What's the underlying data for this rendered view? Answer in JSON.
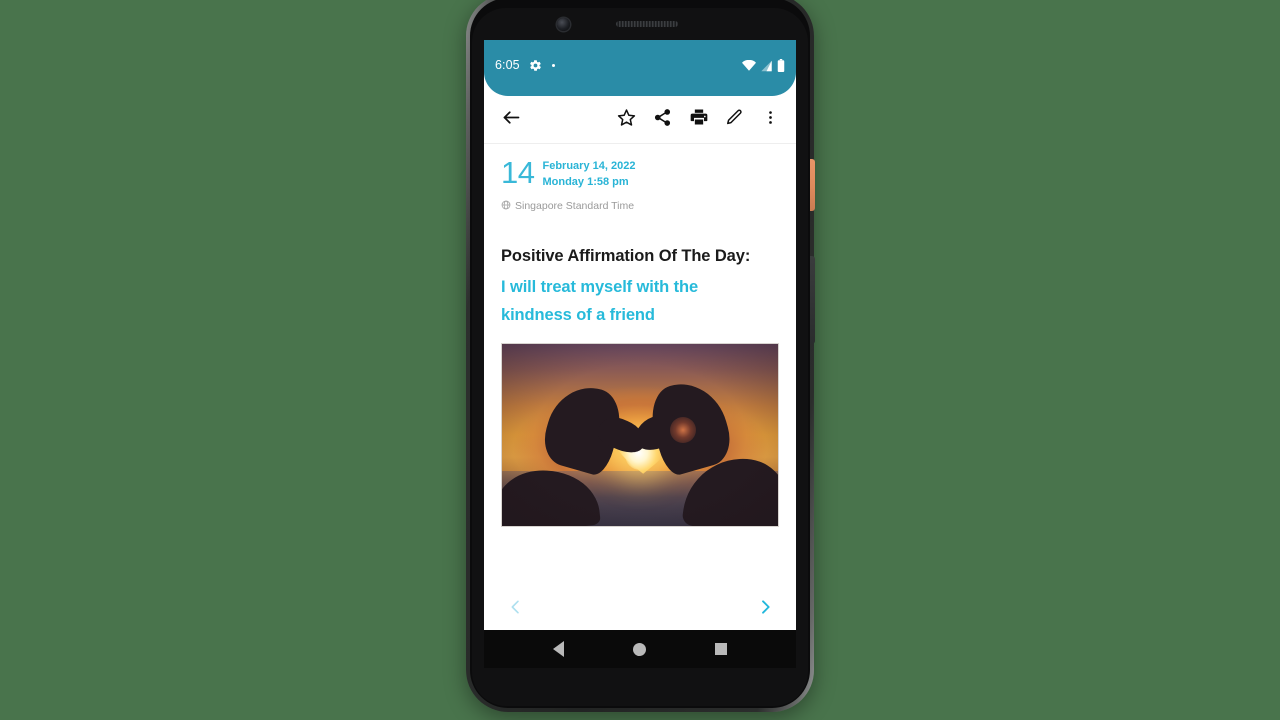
{
  "device": {
    "name": "android-phone",
    "camera_icon": "front-camera",
    "speaker_icon": "earpiece-speaker",
    "power_button": "power-button",
    "volume_button": "volume-rocker"
  },
  "status_bar": {
    "time": "6:05",
    "left_icons": [
      "gear-icon",
      "dot-icon"
    ],
    "right_icons": [
      "wifi-icon",
      "cellular-signal-icon",
      "battery-icon"
    ],
    "background_color": "#2a8ca7"
  },
  "toolbar": {
    "back_icon": "arrow-left-icon",
    "actions": [
      {
        "name": "favorite-button",
        "icon": "star-outline-icon"
      },
      {
        "name": "share-button",
        "icon": "share-icon"
      },
      {
        "name": "print-button",
        "icon": "printer-icon"
      },
      {
        "name": "edit-button",
        "icon": "pencil-icon"
      },
      {
        "name": "overflow-menu-button",
        "icon": "more-vertical-icon"
      }
    ]
  },
  "note": {
    "day_number": "14",
    "date_full": "February 14, 2022",
    "weekday_time": "Monday 1:58 pm",
    "timezone_icon": "globe-icon",
    "timezone": "Singapore Standard Time",
    "title": "Positive Affirmation Of The Day:",
    "affirmation": "I will treat myself with the kindness of a friend",
    "photo_alt": "hands-forming-heart-at-sunset",
    "accent_color": "#27bada",
    "date_color": "#29b4d6"
  },
  "pager": {
    "previous_icon": "chevron-left-icon",
    "next_icon": "chevron-right-icon",
    "previous_enabled": false,
    "next_enabled": true,
    "previous_color": "#aee0ef",
    "next_color": "#22b8dc"
  },
  "android_nav": {
    "back_icon": "nav-back-triangle-icon",
    "home_icon": "nav-home-circle-icon",
    "recents_icon": "nav-recents-square-icon"
  },
  "page_background_color": "#49744c"
}
